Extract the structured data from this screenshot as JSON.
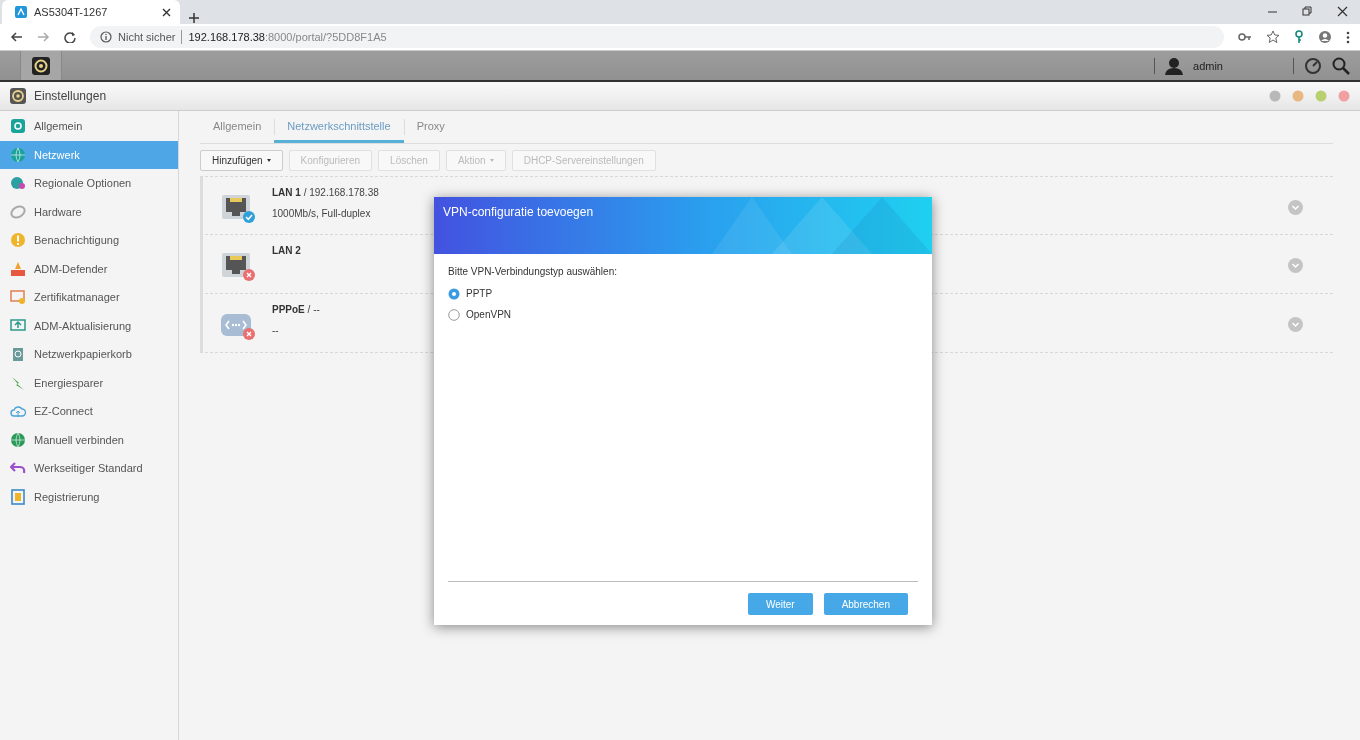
{
  "browser": {
    "tab_title": "AS5304T-1267",
    "security": "Nicht sicher",
    "host": "192.168.178.38",
    "path": ":8000/portal/?5DD8F1A5"
  },
  "topbar": {
    "user": "admin"
  },
  "window": {
    "title": "Einstellungen"
  },
  "sidebar": {
    "items": [
      {
        "label": "Allgemein",
        "selected": false
      },
      {
        "label": "Netzwerk",
        "selected": true
      },
      {
        "label": "Regionale Optionen",
        "selected": false
      },
      {
        "label": "Hardware",
        "selected": false
      },
      {
        "label": "Benachrichtigung",
        "selected": false
      },
      {
        "label": "ADM-Defender",
        "selected": false
      },
      {
        "label": "Zertifikatmanager",
        "selected": false
      },
      {
        "label": "ADM-Aktualisierung",
        "selected": false
      },
      {
        "label": "Netzwerkpapierkorb",
        "selected": false
      },
      {
        "label": "Energiesparer",
        "selected": false
      },
      {
        "label": "EZ-Connect",
        "selected": false
      },
      {
        "label": "Manuell verbinden",
        "selected": false
      },
      {
        "label": "Werkseitiger Standard",
        "selected": false
      },
      {
        "label": "Registrierung",
        "selected": false
      }
    ]
  },
  "tabs": [
    {
      "label": "Allgemein",
      "selected": false
    },
    {
      "label": "Netzwerkschnittstelle",
      "selected": true
    },
    {
      "label": "Proxy",
      "selected": false
    }
  ],
  "toolbar": [
    {
      "label": "Hinzufügen",
      "disabled": false,
      "dropdown": true
    },
    {
      "label": "Konfigurieren",
      "disabled": true,
      "dropdown": false
    },
    {
      "label": "Löschen",
      "disabled": true,
      "dropdown": false
    },
    {
      "label": "Aktion",
      "disabled": true,
      "dropdown": true
    },
    {
      "label": "DHCP-Servereinstellungen",
      "disabled": true,
      "dropdown": false
    }
  ],
  "interfaces": [
    {
      "kind": "ethernet",
      "name": "LAN 1",
      "suffix": "/ 192.168.178.38",
      "status": "1000Mb/s, Full-duplex",
      "connected": true
    },
    {
      "kind": "ethernet",
      "name": "LAN 2",
      "connected": false
    },
    {
      "kind": "pppoe",
      "name": "PPPoE",
      "suffix": "/ --",
      "status": "--",
      "connected": false
    }
  ],
  "dialog": {
    "title": "VPN-configuratie toevoegen",
    "prompt": "Bitte VPN-Verbindungstyp auswählen:",
    "options": [
      {
        "label": "PPTP",
        "selected": true
      },
      {
        "label": "OpenVPN",
        "selected": false
      }
    ],
    "buttons": [
      "Weiter",
      "Abbrechen"
    ]
  }
}
